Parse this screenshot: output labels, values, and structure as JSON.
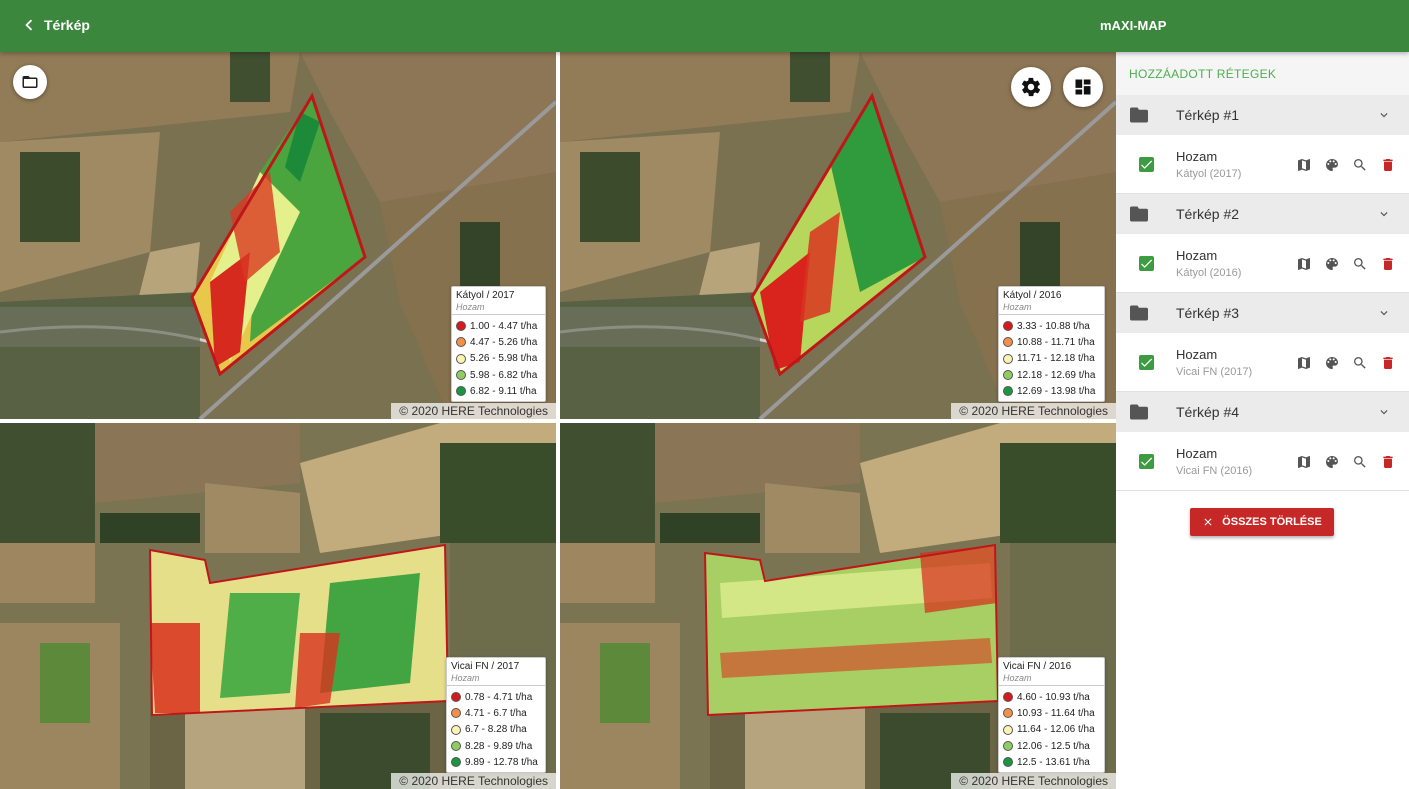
{
  "header": {
    "back_label": "Térkép",
    "app_title": "mAXI-MAP"
  },
  "maps": [
    {
      "legend_title": "Kátyol / 2017",
      "legend_subtitle": "Hozam",
      "legend_items": [
        {
          "label": "1.00 - 4.47 t/ha",
          "color": "#d7191c"
        },
        {
          "label": "4.47 - 5.26 t/ha",
          "color": "#f0904a"
        },
        {
          "label": "5.26 - 5.98 t/ha",
          "color": "#fbf3b4"
        },
        {
          "label": "5.98 - 6.82 t/ha",
          "color": "#8fcd62"
        },
        {
          "label": "6.82 - 9.11 t/ha",
          "color": "#1a9641"
        }
      ],
      "credit": "© 2020 HERE Technologies"
    },
    {
      "legend_title": "Kátyol / 2016",
      "legend_subtitle": "Hozam",
      "legend_items": [
        {
          "label": "3.33 - 10.88 t/ha",
          "color": "#d7191c"
        },
        {
          "label": "10.88 - 11.71 t/ha",
          "color": "#f0904a"
        },
        {
          "label": "11.71 - 12.18 t/ha",
          "color": "#fbf3b4"
        },
        {
          "label": "12.18 - 12.69 t/ha",
          "color": "#8fcd62"
        },
        {
          "label": "12.69 - 13.98 t/ha",
          "color": "#1a9641"
        }
      ],
      "credit": "© 2020 HERE Technologies"
    },
    {
      "legend_title": "Vicai FN / 2017",
      "legend_subtitle": "Hozam",
      "legend_items": [
        {
          "label": "0.78 - 4.71 t/ha",
          "color": "#d7191c"
        },
        {
          "label": "4.71 - 6.7 t/ha",
          "color": "#f0904a"
        },
        {
          "label": "6.7 - 8.28 t/ha",
          "color": "#fbf3b4"
        },
        {
          "label": "8.28 - 9.89 t/ha",
          "color": "#8fcd62"
        },
        {
          "label": "9.89 - 12.78 t/ha",
          "color": "#1a9641"
        }
      ],
      "credit": "© 2020 HERE Technologies"
    },
    {
      "legend_title": "Vicai FN / 2016",
      "legend_subtitle": "Hozam",
      "legend_items": [
        {
          "label": "4.60 - 10.93 t/ha",
          "color": "#d7191c"
        },
        {
          "label": "10.93 - 11.64 t/ha",
          "color": "#f0904a"
        },
        {
          "label": "11.64 - 12.06 t/ha",
          "color": "#fbf3b4"
        },
        {
          "label": "12.06 - 12.5 t/ha",
          "color": "#8fcd62"
        },
        {
          "label": "12.5 - 13.61 t/ha",
          "color": "#1a9641"
        }
      ],
      "credit": "© 2020 HERE Technologies"
    }
  ],
  "map_controls": {
    "folder_icon": "folder-open-icon",
    "settings_icon": "gear-icon",
    "layout_icon": "dashboard-layout-icon"
  },
  "panel": {
    "title": "HOZZÁADOTT RÉTEGEK",
    "groups": [
      {
        "name": "Térkép #1",
        "layer": {
          "name": "Hozam",
          "sub": "Kátyol (2017)",
          "checked": true
        }
      },
      {
        "name": "Térkép #2",
        "layer": {
          "name": "Hozam",
          "sub": "Kátyol (2016)",
          "checked": true
        }
      },
      {
        "name": "Térkép #3",
        "layer": {
          "name": "Hozam",
          "sub": "Vicai FN (2017)",
          "checked": true
        }
      },
      {
        "name": "Térkép #4",
        "layer": {
          "name": "Hozam",
          "sub": "Vicai FN (2016)",
          "checked": true
        }
      }
    ],
    "clear_all_label": "ÖSSZES TÖRLÉSE"
  },
  "colors": {
    "header_bg": "#3b873e",
    "panel_accent": "#4caf50",
    "checkbox": "#3d9b41",
    "delete": "#c62828",
    "clear_button": "#c62828"
  }
}
